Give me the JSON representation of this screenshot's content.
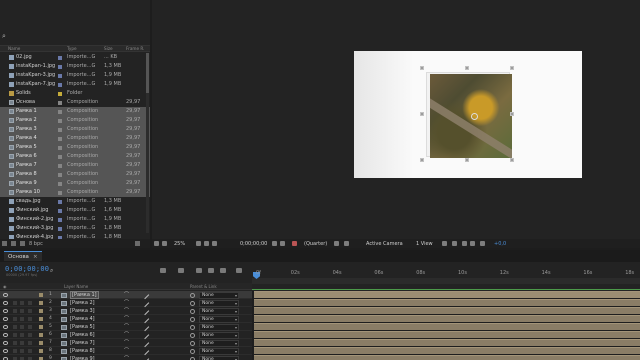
{
  "project": {
    "search_icon": "search-icon",
    "headers": {
      "name": "Name",
      "type": "Type",
      "size": "Size",
      "frame": "Frame R."
    },
    "items": [
      {
        "name": "02.jpg",
        "icon": "file",
        "tag": "blue",
        "type": "Importe...G",
        "size": "... KB",
        "frame": "",
        "selected": false
      },
      {
        "name": "instaKpan-1.jpg",
        "icon": "file",
        "tag": "blue",
        "type": "Importe...G",
        "size": "1,3 MB",
        "frame": "",
        "selected": false
      },
      {
        "name": "instaKpan-3.jpg",
        "icon": "file",
        "tag": "blue",
        "type": "Importe...G",
        "size": "1,9 MB",
        "frame": "",
        "selected": false
      },
      {
        "name": "instaKpan-7.jpg",
        "icon": "file",
        "tag": "blue",
        "type": "Importe...G",
        "size": "1,9 MB",
        "frame": "",
        "selected": false
      },
      {
        "name": "Solids",
        "icon": "folder",
        "tag": "yellow",
        "type": "Folder",
        "size": "",
        "frame": "",
        "selected": false
      },
      {
        "name": "Основа",
        "icon": "comp",
        "tag": "gray",
        "type": "Composition",
        "size": "",
        "frame": "29,97",
        "selected": false
      },
      {
        "name": "Рамка 1",
        "icon": "comp",
        "tag": "gray",
        "type": "Composition",
        "size": "",
        "frame": "29,97",
        "selected": true
      },
      {
        "name": "Рамка 2",
        "icon": "comp",
        "tag": "gray",
        "type": "Composition",
        "size": "",
        "frame": "29,97",
        "selected": true
      },
      {
        "name": "Рамка 3",
        "icon": "comp",
        "tag": "gray",
        "type": "Composition",
        "size": "",
        "frame": "29,97",
        "selected": true
      },
      {
        "name": "Рамка 4",
        "icon": "comp",
        "tag": "gray",
        "type": "Composition",
        "size": "",
        "frame": "29,97",
        "selected": true
      },
      {
        "name": "Рамка 5",
        "icon": "comp",
        "tag": "gray",
        "type": "Composition",
        "size": "",
        "frame": "29,97",
        "selected": true
      },
      {
        "name": "Рамка 6",
        "icon": "comp",
        "tag": "gray",
        "type": "Composition",
        "size": "",
        "frame": "29,97",
        "selected": true
      },
      {
        "name": "Рамка 7",
        "icon": "comp",
        "tag": "gray",
        "type": "Composition",
        "size": "",
        "frame": "29,97",
        "selected": true
      },
      {
        "name": "Рамка 8",
        "icon": "comp",
        "tag": "gray",
        "type": "Composition",
        "size": "",
        "frame": "29,97",
        "selected": true
      },
      {
        "name": "Рамка 9",
        "icon": "comp",
        "tag": "gray",
        "type": "Composition",
        "size": "",
        "frame": "29,97",
        "selected": true
      },
      {
        "name": "Рамка 10",
        "icon": "comp",
        "tag": "gray",
        "type": "Composition",
        "size": "",
        "frame": "29,97",
        "selected": true
      },
      {
        "name": "свадь.jpg",
        "icon": "file",
        "tag": "blue",
        "type": "Importe...G",
        "size": "1,3 MB",
        "frame": "",
        "selected": false
      },
      {
        "name": "Финский.jpg",
        "icon": "file",
        "tag": "blue",
        "type": "Importe...G",
        "size": "1,6 MB",
        "frame": "",
        "selected": false
      },
      {
        "name": "Финский-2.jpg",
        "icon": "file",
        "tag": "blue",
        "type": "Importe...G",
        "size": "1,9 MB",
        "frame": "",
        "selected": false
      },
      {
        "name": "Финский-3.jpg",
        "icon": "file",
        "tag": "blue",
        "type": "Importe...G",
        "size": "1,8 MB",
        "frame": "",
        "selected": false
      },
      {
        "name": "Финский-4.jpg",
        "icon": "file",
        "tag": "blue",
        "type": "Importe...G",
        "size": "1,8 MB",
        "frame": "",
        "selected": false
      }
    ],
    "footer_bpc": "8 bpc"
  },
  "viewer": {
    "zoom": "25%",
    "timecode": "0;00;00;00",
    "resolution": "(Quarter)",
    "camera": "Active Camera",
    "views": "1 View",
    "exposure": "+0,0"
  },
  "timeline": {
    "tab_label": "Основа",
    "current_time": "0;00;00;00",
    "fps_label": "00000 (29.97 fps)",
    "ruler_ticks": [
      "0f",
      "02s",
      "04s",
      "06s",
      "08s",
      "10s",
      "12s",
      "14s",
      "16s",
      "18s"
    ],
    "column_headers": {
      "layer_name": "Layer Name",
      "parent": "Parent & Link"
    },
    "layers": [
      {
        "num": "1",
        "name": "[Рамка 1]",
        "parent": "None",
        "selected": true
      },
      {
        "num": "2",
        "name": "[Рамка 2]",
        "parent": "None",
        "selected": false
      },
      {
        "num": "3",
        "name": "[Рамка 3]",
        "parent": "None",
        "selected": false
      },
      {
        "num": "4",
        "name": "[Рамка 4]",
        "parent": "None",
        "selected": false
      },
      {
        "num": "5",
        "name": "[Рамка 5]",
        "parent": "None",
        "selected": false
      },
      {
        "num": "6",
        "name": "[Рамка 6]",
        "parent": "None",
        "selected": false
      },
      {
        "num": "7",
        "name": "[Рамка 7]",
        "parent": "None",
        "selected": false
      },
      {
        "num": "8",
        "name": "[Рамка 8]",
        "parent": "None",
        "selected": false
      },
      {
        "num": "9",
        "name": "[Рамка 9]",
        "parent": "None",
        "selected": false
      }
    ]
  },
  "colors": {
    "accent_blue": "#4a8ed8",
    "selection": "#555555",
    "track_tan": "#8a7d66",
    "work_area_green": "#4c9a4a"
  }
}
